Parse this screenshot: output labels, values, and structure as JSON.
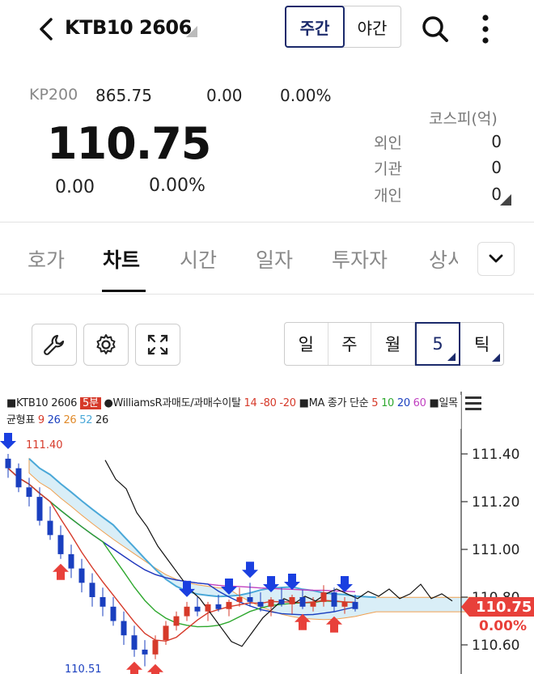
{
  "header": {
    "title": "KTB10 2606",
    "session_tabs": [
      "주간",
      "야간"
    ],
    "active_session": "주간"
  },
  "quote": {
    "index_label": "KP200",
    "index_value": "865.75",
    "index_change": "0.00",
    "index_change_pct": "0.00%",
    "price": "110.75",
    "change": "0.00",
    "change_pct": "0.00%",
    "investor_title": "코스피(억)",
    "investors": [
      {
        "label": "외인",
        "value": "0"
      },
      {
        "label": "기관",
        "value": "0"
      },
      {
        "label": "개인",
        "value": "0"
      }
    ]
  },
  "tabs": [
    "호가",
    "차트",
    "시간",
    "일자",
    "투자자",
    "상시"
  ],
  "active_tab": "차트",
  "period_buttons": [
    "일",
    "주",
    "월",
    "5",
    "틱"
  ],
  "active_period": "5",
  "chart": {
    "legend_name": "KTB10 2606",
    "legend_interval": "5분",
    "legend_wr": "WilliamsR과매도/과매수이탈",
    "legend_wr_params": "14 -80 -20",
    "legend_ma": "MA 종가 단순",
    "ma_periods": [
      "5",
      "10",
      "20",
      "60"
    ],
    "legend_ichimoku": "일목균형표",
    "ichimoku_params": [
      "9",
      "26",
      "26",
      "52",
      "26"
    ],
    "high_label": "111.40",
    "low_label": "110.51",
    "current_price_tag": "110.75",
    "current_pct_tag": "0.00%",
    "menu_icon": "hamburger-icon"
  },
  "chart_data": {
    "type": "candlestick",
    "ylim": [
      110.5,
      111.5
    ],
    "y_ticks": [
      110.6,
      110.8,
      111.0,
      111.2,
      111.4
    ],
    "y_tick_labels": [
      "110.60",
      "110.80",
      "111.00",
      "111.20",
      "111.40"
    ],
    "series_names": [
      "5",
      "10",
      "20",
      "60"
    ],
    "up_color": "#d63a2a",
    "down_color": "#1a3fbf",
    "ohlc": [
      [
        111.38,
        111.4,
        111.3,
        111.34
      ],
      [
        111.34,
        111.36,
        111.24,
        111.26
      ],
      [
        111.26,
        111.3,
        111.18,
        111.22
      ],
      [
        111.22,
        111.26,
        111.1,
        111.12
      ],
      [
        111.12,
        111.18,
        111.04,
        111.06
      ],
      [
        111.06,
        111.1,
        110.96,
        110.98
      ],
      [
        110.98,
        111.02,
        110.88,
        110.92
      ],
      [
        110.92,
        110.96,
        110.82,
        110.86
      ],
      [
        110.86,
        110.9,
        110.76,
        110.8
      ],
      [
        110.8,
        110.84,
        110.72,
        110.76
      ],
      [
        110.76,
        110.8,
        110.68,
        110.7
      ],
      [
        110.7,
        110.74,
        110.6,
        110.64
      ],
      [
        110.64,
        110.68,
        110.55,
        110.58
      ],
      [
        110.58,
        110.62,
        110.51,
        110.56
      ],
      [
        110.56,
        110.64,
        110.54,
        110.62
      ],
      [
        110.62,
        110.7,
        110.6,
        110.68
      ],
      [
        110.68,
        110.74,
        110.66,
        110.72
      ],
      [
        110.72,
        110.78,
        110.7,
        110.76
      ],
      [
        110.76,
        110.8,
        110.72,
        110.74
      ],
      [
        110.74,
        110.78,
        110.7,
        110.77
      ],
      [
        110.77,
        110.81,
        110.74,
        110.75
      ],
      [
        110.75,
        110.79,
        110.72,
        110.78
      ],
      [
        110.78,
        110.84,
        110.76,
        110.8
      ],
      [
        110.8,
        110.86,
        110.76,
        110.78
      ],
      [
        110.78,
        110.82,
        110.74,
        110.76
      ],
      [
        110.76,
        110.8,
        110.72,
        110.79
      ],
      [
        110.79,
        110.84,
        110.76,
        110.77
      ],
      [
        110.77,
        110.81,
        110.73,
        110.8
      ],
      [
        110.8,
        110.83,
        110.75,
        110.76
      ],
      [
        110.76,
        110.8,
        110.74,
        110.78
      ],
      [
        110.78,
        110.85,
        110.76,
        110.82
      ],
      [
        110.82,
        110.84,
        110.74,
        110.76
      ],
      [
        110.76,
        110.8,
        110.73,
        110.78
      ],
      [
        110.78,
        110.81,
        110.74,
        110.75
      ]
    ],
    "buy_signal_bars": [
      5,
      12,
      14,
      28,
      31
    ],
    "sell_signal_bars": [
      0,
      17,
      21,
      23,
      25,
      27,
      32
    ]
  }
}
